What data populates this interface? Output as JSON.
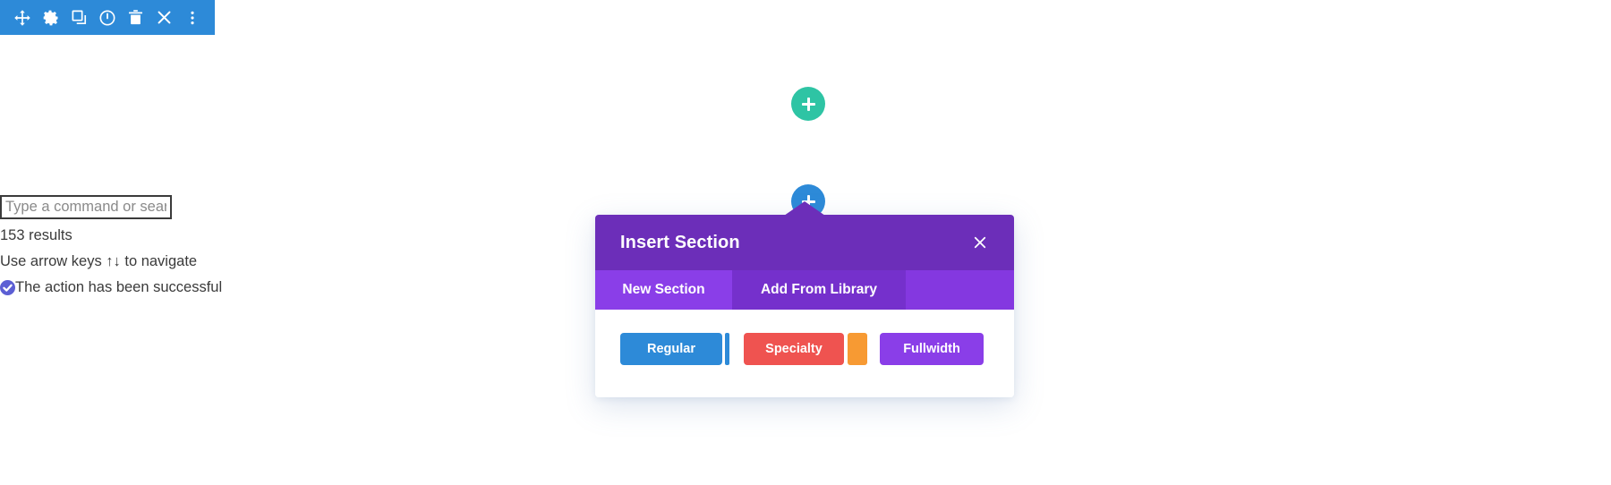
{
  "toolbar": {
    "icons": [
      {
        "name": "move-icon",
        "label": "Move"
      },
      {
        "name": "gear-icon",
        "label": "Settings"
      },
      {
        "name": "duplicate-icon",
        "label": "Duplicate"
      },
      {
        "name": "power-icon",
        "label": "Disable"
      },
      {
        "name": "trash-icon",
        "label": "Delete"
      },
      {
        "name": "close-icon",
        "label": "Close"
      },
      {
        "name": "more-options-icon",
        "label": "More Options"
      }
    ],
    "background_color": "#2d8ad8"
  },
  "canvas": {
    "add_row_button": {
      "label": "+",
      "color": "#2ec4a4"
    },
    "add_section_button": {
      "label": "+",
      "color": "#2d8ad8"
    }
  },
  "command_palette": {
    "search_placeholder": "Type a command or search",
    "search_value": "",
    "results_count": "153 results",
    "navigate_hint": "Use arrow keys ↑↓ to navigate",
    "status_message": "The action has been successful",
    "status_icon": "check-circle-icon",
    "status_color": "#5c5fd4"
  },
  "modal": {
    "title": "Insert Section",
    "close_label": "×",
    "header_color": "#6c2eb9",
    "tabs": [
      {
        "label": "New Section",
        "active": true
      },
      {
        "label": "Add From Library",
        "active": false
      }
    ],
    "section_types": [
      {
        "label": "Regular",
        "color": "#2d8ad8"
      },
      {
        "label": "Specialty",
        "color": "#ef5350"
      },
      {
        "label": "Fullwidth",
        "color": "#8a3ee8"
      }
    ],
    "accent_blue": "#2d8ad8",
    "accent_orange": "#f79a33"
  }
}
